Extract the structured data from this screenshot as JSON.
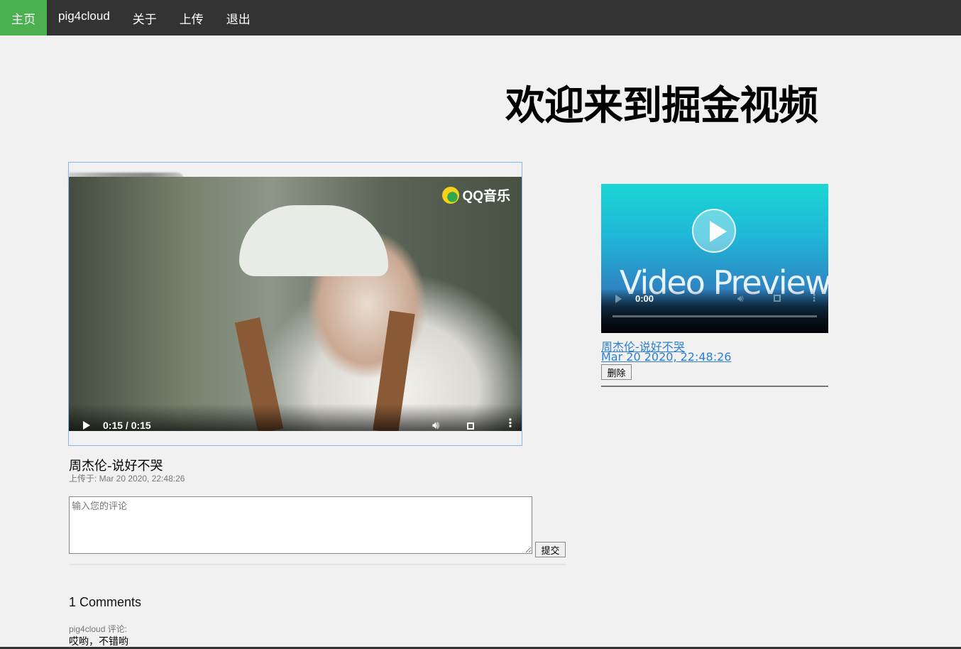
{
  "nav": {
    "items": [
      {
        "label": "主页",
        "active": true
      },
      {
        "label": "pig4cloud",
        "active": false
      },
      {
        "label": "关于",
        "active": false
      },
      {
        "label": "上传",
        "active": false
      },
      {
        "label": "退出",
        "active": false
      }
    ],
    "active_color": "#4caf50",
    "bar_color": "#333333"
  },
  "headline": "欢迎来到掘金视频",
  "main_video": {
    "overlay_brand": "QQ音乐",
    "time": "0:15 / 0:15",
    "progress": 1.0,
    "title": "周杰伦-说好不哭",
    "uploaded": "上传于: Mar 20 2020, 22:48:26",
    "icons": [
      "play-icon",
      "volume-icon",
      "fullscreen-icon",
      "more-options-icon"
    ]
  },
  "comment_form": {
    "placeholder": "输入您的评论",
    "submit_label": "提交"
  },
  "comments": {
    "count_label": "1 Comments",
    "items": [
      {
        "author": "pig4cloud 评论:",
        "text": "哎哟，不错哟"
      }
    ]
  },
  "sidebar_video": {
    "thumbnail_text": "Video Preview",
    "time": "0:00",
    "title": "周杰伦-说好不哭",
    "date": "Mar 20 2020, 22:48:26",
    "delete_label": "删除",
    "link_color": "#2b7fd4"
  }
}
